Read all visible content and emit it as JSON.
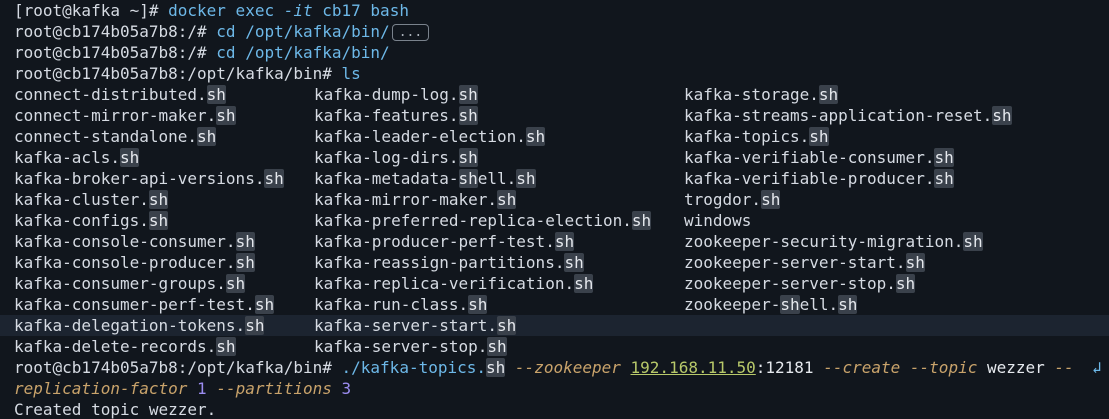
{
  "terminal": {
    "prompt_host": "[root@kafka ~]# ",
    "cmd1_a": "docker exec ",
    "cmd1_flag": "-it",
    "cmd1_b": " cb17 bash",
    "container_prompt_root": "root@cb174b05a7b8:/# ",
    "cd_cmd": "cd /opt/kafka/bin/",
    "ellipsis": "...",
    "bin_prompt": "root@cb174b05a7b8:/opt/kafka/bin# ",
    "ls_cmd": "ls",
    "sh_ext": "sh",
    "files_col1": [
      "connect-distributed.",
      "connect-mirror-maker.",
      "connect-standalone.",
      "kafka-acls.",
      "kafka-broker-api-versions.",
      "kafka-cluster.",
      "kafka-configs.",
      "kafka-console-consumer.",
      "kafka-console-producer.",
      "kafka-consumer-groups.",
      "kafka-consumer-perf-test.",
      "kafka-delegation-tokens.",
      "kafka-delete-records."
    ],
    "files_col2": [
      "kafka-dump-log.",
      "kafka-features.",
      "kafka-leader-election.",
      "kafka-log-dirs.",
      "kafka-metadata-",
      "kafka-mirror-maker.",
      "kafka-preferred-replica-election.",
      "kafka-producer-perf-test.",
      "kafka-reassign-partitions.",
      "kafka-replica-verification.",
      "kafka-run-class.",
      "kafka-server-start.",
      "kafka-server-stop."
    ],
    "metadata_shell_tail": "ell.",
    "files_col3": [
      "kafka-storage.",
      "kafka-streams-application-reset.",
      "kafka-topics.",
      "kafka-verifiable-consumer.",
      "kafka-verifiable-producer.",
      "trogdor.",
      "windows",
      "zookeeper-security-migration.",
      "zookeeper-server-start.",
      "zookeeper-server-stop.",
      "zookeeper-"
    ],
    "zk_shell_tail": "ell.",
    "topics_cmd_a": "./kafka-topics.",
    "opt_zookeeper": "--zookeeper",
    "ip": "192.168.11.50",
    "port": ":12181",
    "opt_create": "--create",
    "opt_topic": "--topic",
    "topic_name": "wezzer",
    "dashdash": "--",
    "wrap_icon": "↲",
    "opt_replication": "replication-factor",
    "replication_value": "1",
    "opt_partitions": "--partitions",
    "partitions_value": "3",
    "output": "Created topic wezzer."
  }
}
